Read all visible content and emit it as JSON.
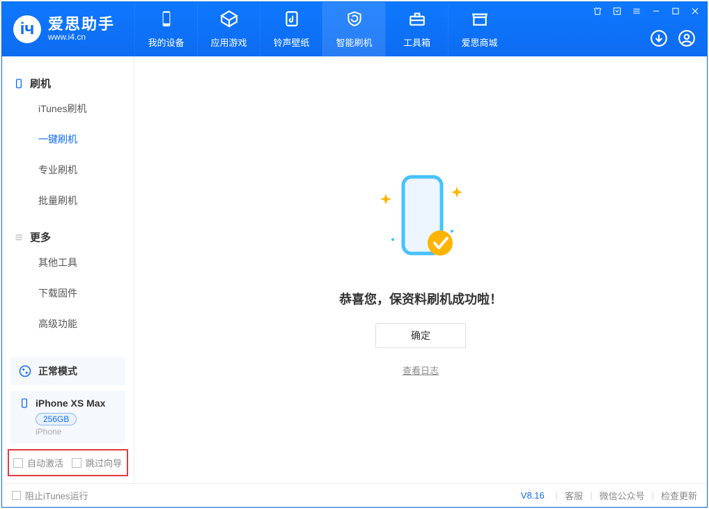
{
  "app": {
    "name": "爱思助手",
    "domain": "www.i4.cn"
  },
  "nav": [
    {
      "key": "my-device",
      "label": "我的设备"
    },
    {
      "key": "apps-games",
      "label": "应用游戏"
    },
    {
      "key": "ring-wall",
      "label": "铃声壁纸"
    },
    {
      "key": "smart-flash",
      "label": "智能刷机"
    },
    {
      "key": "toolbox",
      "label": "工具箱"
    },
    {
      "key": "store",
      "label": "爱思商城"
    }
  ],
  "sidebar": {
    "groups": [
      {
        "key": "flash",
        "title": "刷机",
        "items": [
          {
            "key": "itunes-flash",
            "label": "iTunes刷机"
          },
          {
            "key": "oneclick-flash",
            "label": "一键刷机",
            "active": true
          },
          {
            "key": "pro-flash",
            "label": "专业刷机"
          },
          {
            "key": "batch-flash",
            "label": "批量刷机"
          }
        ]
      },
      {
        "key": "more",
        "title": "更多",
        "items": [
          {
            "key": "other-tools",
            "label": "其他工具"
          },
          {
            "key": "download-fw",
            "label": "下载固件"
          },
          {
            "key": "advanced",
            "label": "高级功能"
          }
        ]
      }
    ],
    "status": "正常模式",
    "device": {
      "name": "iPhone XS Max",
      "capacity": "256GB",
      "type": "iPhone"
    },
    "options": {
      "auto_activate": "自动激活",
      "skip_guide": "跳过向导"
    }
  },
  "main": {
    "message": "恭喜您，保资料刷机成功啦！",
    "confirm_label": "确定",
    "view_log_label": "查看日志"
  },
  "footer": {
    "block_itunes": "阻止iTunes运行",
    "version": "V8.16",
    "links": [
      "客服",
      "微信公众号",
      "检查更新"
    ]
  }
}
